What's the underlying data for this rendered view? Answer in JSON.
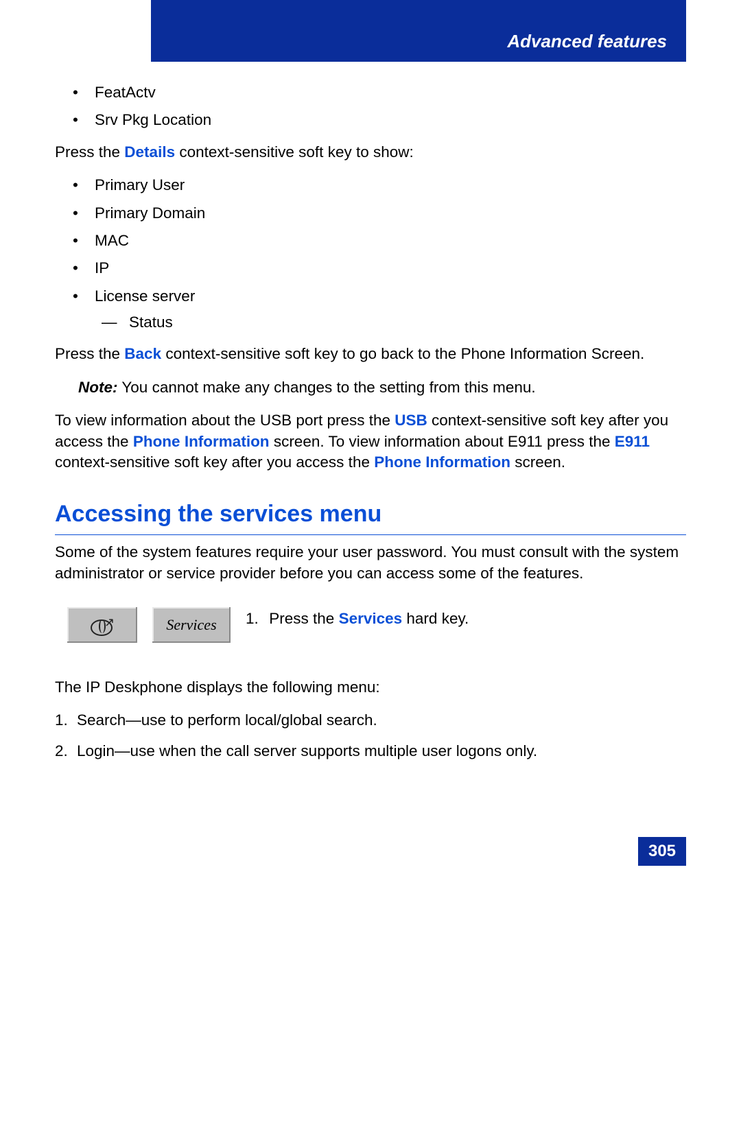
{
  "header": {
    "title": "Advanced features"
  },
  "top_bullets": [
    "FeatActv",
    "Srv Pkg Location"
  ],
  "details_sentence": {
    "pre": "Press the ",
    "key": "Details",
    "post": " context-sensitive soft key to show:"
  },
  "details_list": [
    "Primary User",
    "Primary Domain",
    "MAC",
    "IP",
    "License server"
  ],
  "sub_list": [
    "Status"
  ],
  "back_sentence": {
    "pre": "Press the ",
    "key": "Back",
    "post": " context-sensitive soft key to go back to the Phone Information Screen."
  },
  "note": {
    "label": "Note:",
    "text": "  You cannot make any changes to the setting from this menu."
  },
  "usb_para": {
    "p1": "To view information about the USB port press the ",
    "usb": "USB",
    "p2": " context-sensitive soft key after you access the ",
    "phone1": "Phone Information",
    "p3": " screen. To view information about E911 press the ",
    "e911": "E911",
    "p4": " context-sensitive soft key after you access the ",
    "phone2": "Phone Information",
    "p5": " screen."
  },
  "section_heading": "Accessing the services menu",
  "intro_para": "Some of the system features require your user password. You must consult with the system administrator or service provider before you can access some of the features.",
  "services_label": "Services",
  "step1": {
    "num": "1.",
    "pre": "Press the ",
    "key": "Services",
    "post": " hard key."
  },
  "menu_intro": "The IP Deskphone displays the following menu:",
  "menu_items": [
    "Search—use to perform local/global search.",
    "Login—use when the call server supports multiple user logons only."
  ],
  "page_number": "305"
}
